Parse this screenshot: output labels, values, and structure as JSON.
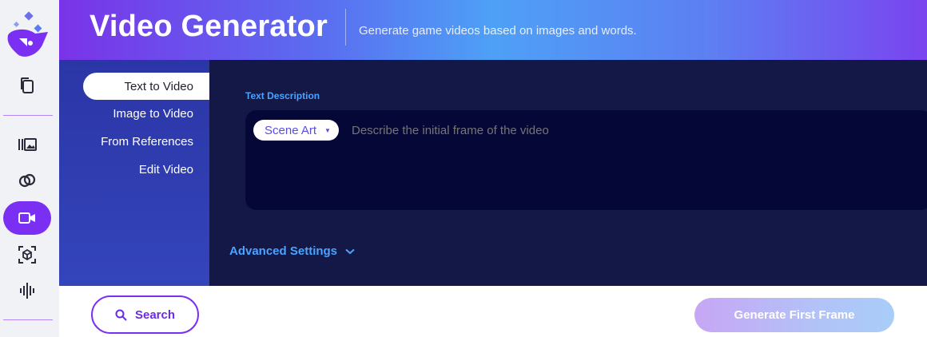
{
  "header": {
    "title": "Video Generator",
    "subtitle": "Generate game videos based on images and words."
  },
  "rail": {
    "items": [
      {
        "icon": "copy-icon",
        "active": false
      },
      {
        "icon": "gallery-icon",
        "active": false
      },
      {
        "icon": "rings-icon",
        "active": false
      },
      {
        "icon": "video-camera-icon",
        "active": true
      },
      {
        "icon": "3d-cube-icon",
        "active": false
      },
      {
        "icon": "audio-wave-icon",
        "active": false
      }
    ]
  },
  "subnav": {
    "items": [
      {
        "label": "Text to Video",
        "active": true
      },
      {
        "label": "Image to Video",
        "active": false
      },
      {
        "label": "From References",
        "active": false
      },
      {
        "label": "Edit Video",
        "active": false
      }
    ]
  },
  "form": {
    "section_label": "Text Description",
    "style_chip": "Scene Art",
    "description_placeholder": "Describe the initial frame of the video",
    "description_value": "",
    "advanced_label": "Advanced Settings"
  },
  "actions": {
    "search_label": "Search",
    "generate_label": "Generate First Frame"
  },
  "colors": {
    "accent": "#7b2ff2",
    "link": "#4aa3ff",
    "panel": "#141846",
    "input_bg": "#050836"
  }
}
